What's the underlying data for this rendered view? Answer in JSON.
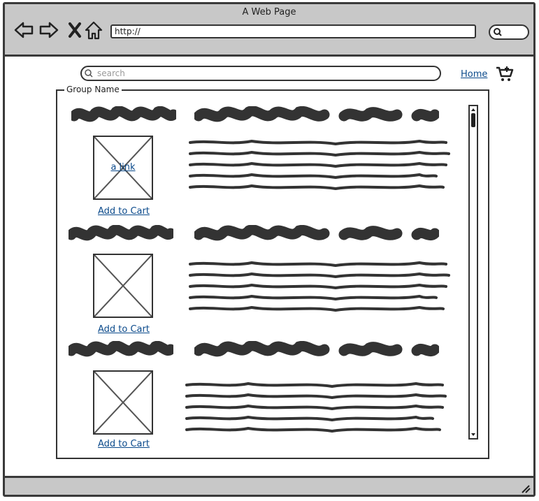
{
  "window": {
    "title": "A Web Page"
  },
  "browser": {
    "url": "http://"
  },
  "header": {
    "search_placeholder": "search",
    "home_link": "Home"
  },
  "group": {
    "name": "Group Name",
    "items": [
      {
        "image_link": "a link",
        "add_to_cart": "Add to Cart"
      },
      {
        "image_link": "",
        "add_to_cart": "Add to Cart"
      },
      {
        "image_link": "",
        "add_to_cart": "Add to Cart"
      }
    ]
  },
  "icons": {
    "back": "back-arrow-icon",
    "forward": "forward-arrow-icon",
    "stop": "close-icon",
    "home": "home-icon",
    "search": "search-icon",
    "cart": "cart-icon"
  },
  "colors": {
    "chrome": "#c8c8c8",
    "link": "#0b4a8b",
    "ink": "#333333"
  }
}
